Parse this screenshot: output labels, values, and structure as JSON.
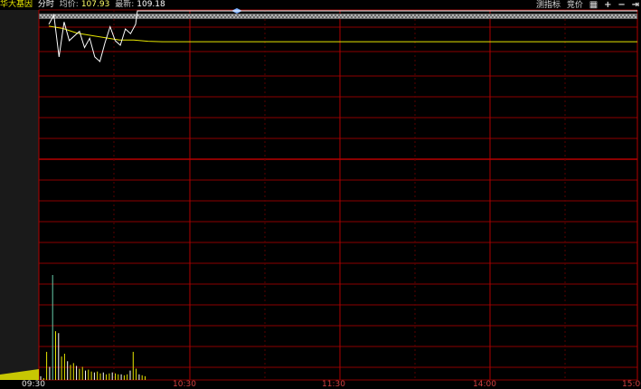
{
  "header": {
    "title": "华大基因",
    "mode": "分时",
    "avg_label": "均价:",
    "avg_value": "107.93",
    "last_label": "最新:",
    "last_value": "109.18"
  },
  "toolbar": {
    "indicator_label": "测指标",
    "auction_label": "竞价",
    "icons": [
      "grid-icon",
      "plus-icon",
      "minus-icon",
      "skip-icon"
    ]
  },
  "time_axis": [
    "09:30",
    "10:30",
    "11:30",
    "14:00",
    "15:00"
  ],
  "colors": {
    "background": "#000000",
    "grid": "#8b0000",
    "price_line": "#ffffff",
    "avg_line": "#e6e600",
    "volume": "#e6e600",
    "left_panel": "#1a1a1a"
  },
  "chart_data": {
    "type": "line",
    "x_range": [
      "09:30",
      "15:00"
    ],
    "price_series": {
      "values": [
        108.6,
        109.0,
        107.2,
        108.7,
        107.9,
        108.1,
        108.3,
        107.6,
        108.0,
        107.2,
        107.0,
        107.8,
        108.5,
        107.9,
        107.7,
        108.4,
        108.2,
        108.6,
        109.18
      ]
    },
    "avg_series": {
      "values": [
        108.6,
        108.5,
        108.3,
        108.2,
        108.1,
        108.0,
        108.0,
        107.95,
        107.93,
        107.93
      ]
    },
    "volume_series": {
      "values": [
        4,
        2,
        30,
        14,
        112,
        52,
        50,
        25,
        28,
        20,
        16,
        18,
        15,
        12,
        14,
        10,
        11,
        9,
        8,
        9,
        7,
        8,
        6,
        7,
        8,
        7,
        6,
        6,
        5,
        6,
        10,
        30,
        12,
        6,
        5,
        4
      ]
    }
  }
}
